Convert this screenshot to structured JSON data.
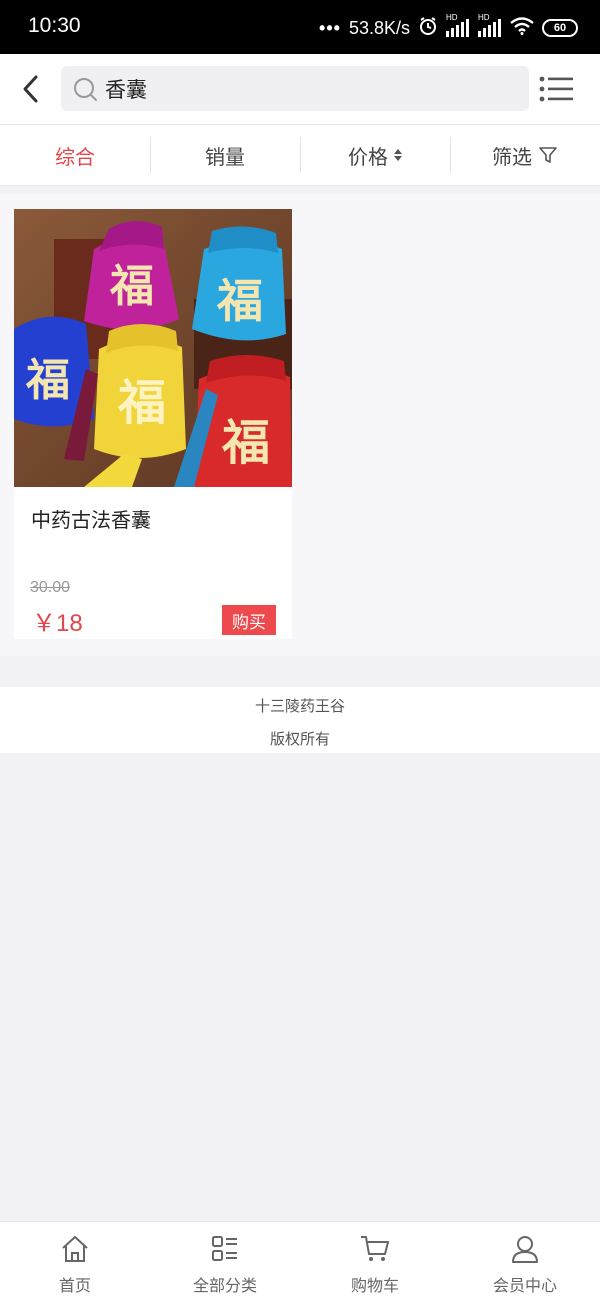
{
  "status_bar": {
    "time": "10:30",
    "network_speed": "53.8K/s",
    "signal_label_1": "HD",
    "signal_label_2": "HD",
    "battery": "60"
  },
  "search": {
    "query": "香囊",
    "icon": "search-icon"
  },
  "sort_tabs": [
    {
      "label": "综合",
      "active": true
    },
    {
      "label": "销量",
      "active": false
    },
    {
      "label": "价格",
      "active": false
    },
    {
      "label": "筛选",
      "active": false
    }
  ],
  "products": [
    {
      "name": "中药古法香囊",
      "original_price": "30.00",
      "price": "￥18",
      "buy_label": "购买",
      "image_char": "福"
    }
  ],
  "footer": {
    "company": "十三陵药王谷",
    "rights": "版权所有"
  },
  "bottom_nav": [
    {
      "label": "首页",
      "icon": "home-icon"
    },
    {
      "label": "全部分类",
      "icon": "category-icon"
    },
    {
      "label": "购物车",
      "icon": "cart-icon"
    },
    {
      "label": "会员中心",
      "icon": "user-icon"
    }
  ],
  "colors": {
    "accent": "#e0474c",
    "buy_button": "#ee4a4e",
    "page_background": "#f2f1f5"
  }
}
